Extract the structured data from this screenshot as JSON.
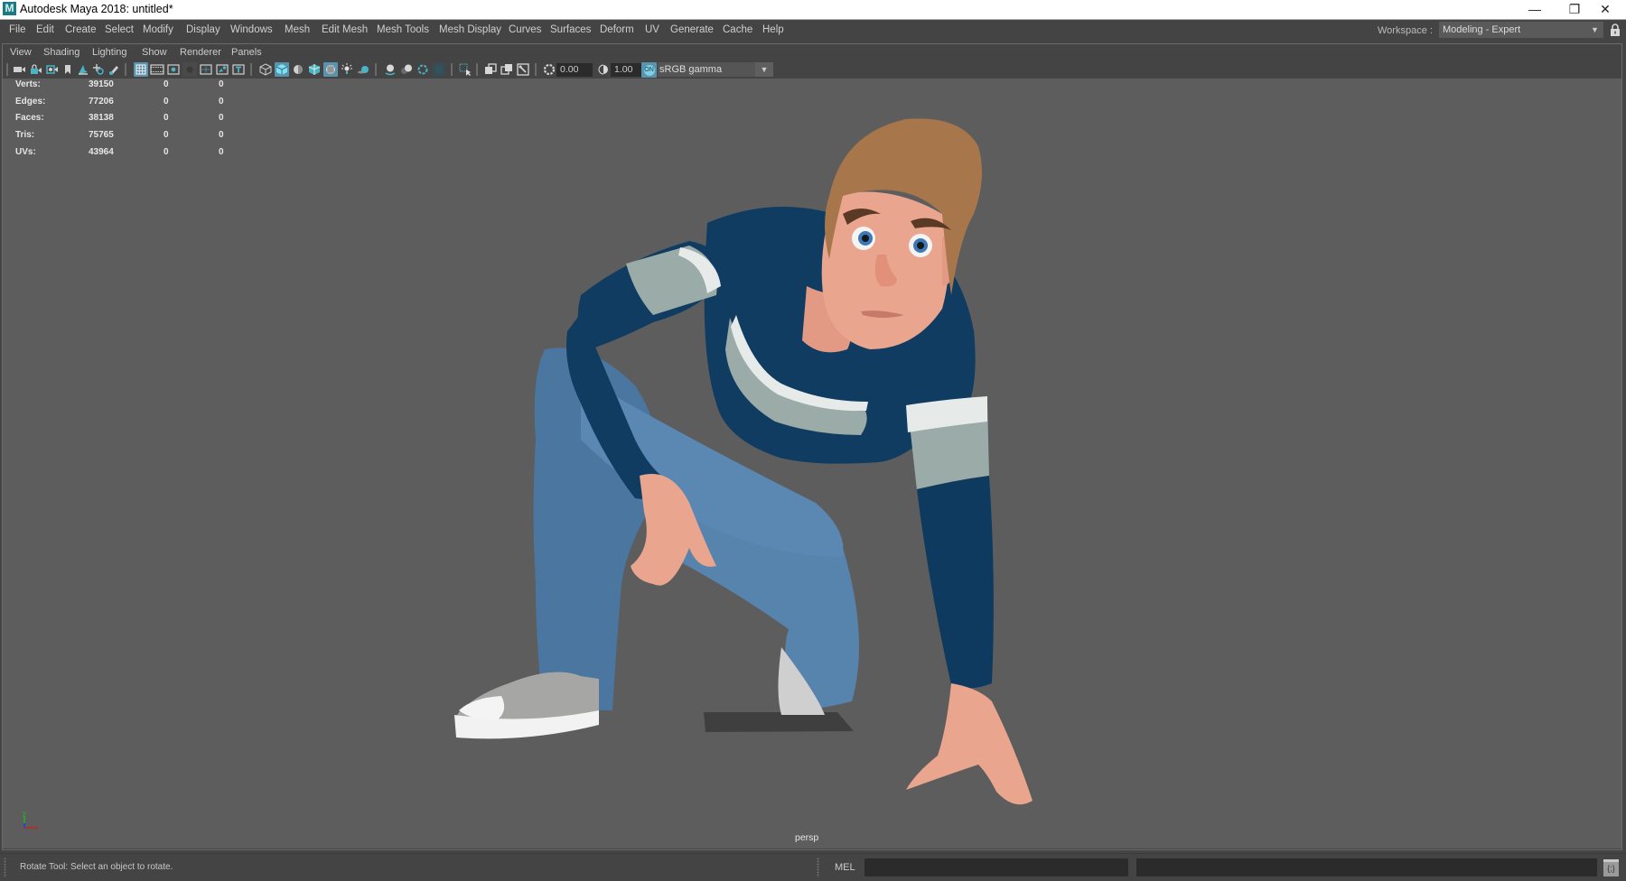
{
  "window": {
    "title": "Autodesk Maya 2018: untitled*",
    "app_icon_letter": "M",
    "minimize_glyph": "—",
    "restore_glyph": "❐",
    "close_glyph": "✕"
  },
  "menubar": {
    "items": [
      "File",
      "Edit",
      "Create",
      "Select",
      "Modify",
      "Display",
      "Windows",
      "Mesh",
      "Edit Mesh",
      "Mesh Tools",
      "Mesh Display",
      "Curves",
      "Surfaces",
      "Deform",
      "UV",
      "Generate",
      "Cache",
      "Help"
    ],
    "workspace_label": "Workspace :",
    "workspace_value": "Modeling - Expert",
    "dropdown_glyph": "▼"
  },
  "panel_menu": {
    "items": [
      "View",
      "Shading",
      "Lighting",
      "Show",
      "Renderer",
      "Panels"
    ]
  },
  "toolbar": {
    "icons": [
      {
        "name": "select-camera-icon",
        "active": false
      },
      {
        "name": "lock-camera-icon",
        "active": false
      },
      {
        "name": "camera-attributes-icon",
        "active": false
      },
      {
        "name": "bookmark-icon",
        "active": false
      },
      {
        "name": "image-plane-icon",
        "active": false
      },
      {
        "name": "2d-pan-zoom-icon",
        "active": false
      },
      {
        "name": "grease-pencil-icon",
        "active": false
      },
      {
        "name": "grid-icon",
        "active": true
      },
      {
        "name": "film-gate-icon",
        "active": false
      },
      {
        "name": "resolution-gate-icon",
        "active": false
      },
      {
        "name": "gate-mask-icon",
        "active": false
      },
      {
        "name": "field-chart-icon",
        "active": false
      },
      {
        "name": "safe-action-icon",
        "active": false
      },
      {
        "name": "safe-title-icon",
        "active": false
      },
      {
        "name": "wireframe-icon",
        "active": false
      },
      {
        "name": "smooth-shade-icon",
        "active": true
      },
      {
        "name": "default-material-icon",
        "active": false
      },
      {
        "name": "wireframe-on-shaded-icon",
        "active": false
      },
      {
        "name": "textured-icon",
        "active": true
      },
      {
        "name": "use-all-lights-icon",
        "active": false
      },
      {
        "name": "shadows-icon",
        "active": false
      },
      {
        "name": "screen-space-ao-icon",
        "active": false
      },
      {
        "name": "motion-blur-icon",
        "active": false
      },
      {
        "name": "anti-aliasing-icon",
        "active": false
      },
      {
        "name": "depth-of-field-icon",
        "active": false
      },
      {
        "name": "isolate-select-icon",
        "active": false
      },
      {
        "name": "xray-icon",
        "active": false
      },
      {
        "name": "xray-active-components-icon",
        "active": false
      },
      {
        "name": "xray-joints-icon",
        "active": false
      }
    ],
    "exposure_value": "0.00",
    "gamma_value": "1.00",
    "color_management_badge": "ON",
    "view_transform": "sRGB gamma"
  },
  "hud": {
    "rows": [
      {
        "label": "Verts:",
        "total": "39150",
        "selected": "0",
        "other": "0"
      },
      {
        "label": "Edges:",
        "total": "77206",
        "selected": "0",
        "other": "0"
      },
      {
        "label": "Faces:",
        "total": "38138",
        "selected": "0",
        "other": "0"
      },
      {
        "label": "Tris:",
        "total": "75765",
        "selected": "0",
        "other": "0"
      },
      {
        "label": "UVs:",
        "total": "43964",
        "selected": "0",
        "other": "0"
      }
    ]
  },
  "viewport": {
    "camera": "persp",
    "axis_labels": {
      "x": "x",
      "y": "y",
      "z": "z"
    },
    "colors": {
      "background": "#5d5d5d",
      "sweater": "#0e3a5e",
      "stripe_light": "#e6ebe9",
      "stripe_mid": "#9aaba8",
      "jeans": "#4c78a3",
      "skin": "#eaa58e",
      "hair": "#a7764b",
      "shoe": "#a6a6a4"
    }
  },
  "statusbar": {
    "help_line": "Rotate Tool: Select an object to rotate.",
    "command_language": "MEL",
    "script_editor_glyph": "{;}"
  }
}
